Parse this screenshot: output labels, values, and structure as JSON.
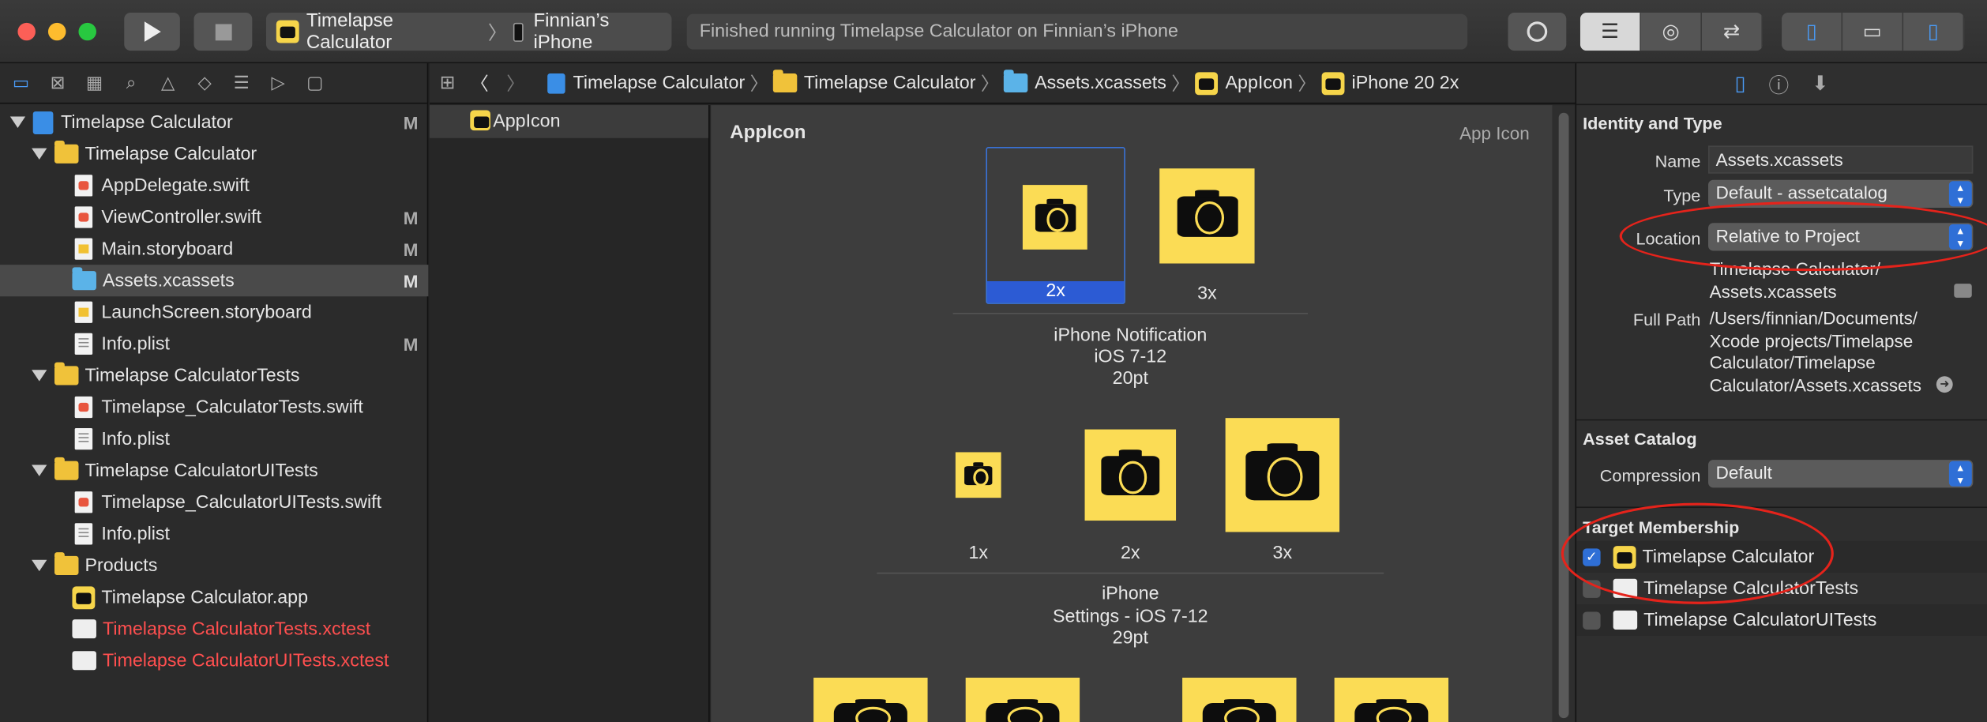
{
  "toolbar": {
    "scheme_target": "Timelapse Calculator",
    "scheme_device": "Finnian’s iPhone",
    "status_message": "Finished running Timelapse Calculator on Finnian’s iPhone"
  },
  "navigator": {
    "items": [
      {
        "label": "Timelapse Calculator",
        "badge": "M"
      },
      {
        "label": "Timelapse Calculator",
        "badge": ""
      },
      {
        "label": "AppDelegate.swift",
        "badge": ""
      },
      {
        "label": "ViewController.swift",
        "badge": "M"
      },
      {
        "label": "Main.storyboard",
        "badge": "M"
      },
      {
        "label": "Assets.xcassets",
        "badge": "M"
      },
      {
        "label": "LaunchScreen.storyboard",
        "badge": ""
      },
      {
        "label": "Info.plist",
        "badge": "M"
      },
      {
        "label": "Timelapse CalculatorTests",
        "badge": ""
      },
      {
        "label": "Timelapse_CalculatorTests.swift",
        "badge": ""
      },
      {
        "label": "Info.plist",
        "badge": ""
      },
      {
        "label": "Timelapse CalculatorUITests",
        "badge": ""
      },
      {
        "label": "Timelapse_CalculatorUITests.swift",
        "badge": ""
      },
      {
        "label": "Info.plist",
        "badge": ""
      },
      {
        "label": "Products",
        "badge": ""
      },
      {
        "label": "Timelapse Calculator.app",
        "badge": ""
      },
      {
        "label": "Timelapse CalculatorTests.xctest",
        "badge": ""
      },
      {
        "label": "Timelapse CalculatorUITests.xctest",
        "badge": ""
      }
    ]
  },
  "jumpbar": {
    "crumbs": [
      "Timelapse Calculator",
      "Timelapse Calculator",
      "Assets.xcassets",
      "AppIcon",
      "iPhone 20 2x"
    ]
  },
  "assets": {
    "item": "AppIcon"
  },
  "editor": {
    "title": "AppIcon",
    "subtitle": "App Icon",
    "group1": {
      "slot_2x": "2x",
      "slot_3x": "3x",
      "name": "iPhone Notification",
      "os": "iOS 7-12",
      "size": "20pt"
    },
    "group2": {
      "slot_1x": "1x",
      "slot_2x": "2x",
      "slot_3x": "3x",
      "name": "iPhone",
      "os": "Settings - iOS 7-12",
      "size": "29pt"
    }
  },
  "inspector": {
    "identity_title": "Identity and Type",
    "name_label": "Name",
    "name_value": "Assets.xcassets",
    "type_label": "Type",
    "type_value": "Default - assetcatalog",
    "location_label": "Location",
    "location_value": "Relative to Project",
    "location_path": "Timelapse Calculator/\nAssets.xcassets",
    "fullpath_label": "Full Path",
    "fullpath_value": "/Users/finnian/Documents/\nXcode projects/Timelapse\nCalculator/Timelapse\nCalculator/Assets.xcassets",
    "catalog_title": "Asset Catalog",
    "compression_label": "Compression",
    "compression_value": "Default",
    "membership_title": "Target Membership",
    "targets": [
      {
        "label": "Timelapse Calculator",
        "checked": true
      },
      {
        "label": "Timelapse CalculatorTests",
        "checked": false
      },
      {
        "label": "Timelapse CalculatorUITests",
        "checked": false
      }
    ]
  },
  "colors": {
    "accent": "#2f6fd6",
    "annotation": "#e5231b",
    "icon_yellow": "#fbdc55"
  }
}
